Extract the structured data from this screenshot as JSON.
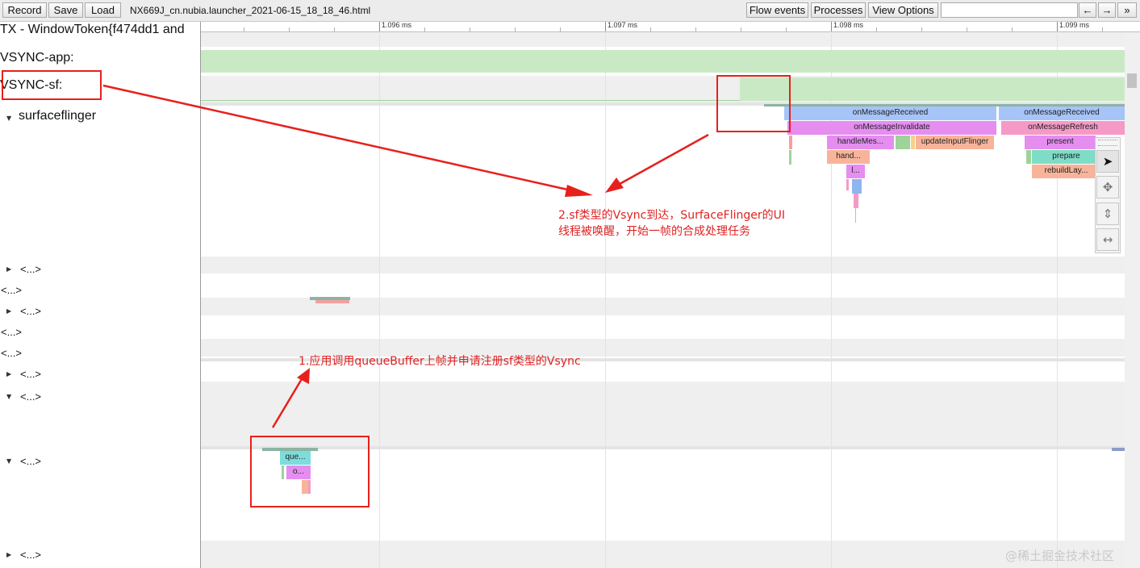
{
  "toolbar": {
    "record": "Record",
    "save": "Save",
    "load": "Load",
    "filename": "NX669J_cn.nubia.launcher_2021-06-15_18_18_46.html",
    "flow_events": "Flow events",
    "processes": "Processes",
    "view_options": "View Options",
    "prev": "←",
    "next": "→",
    "more": "»"
  },
  "left_panel": {
    "row0": "TX - WindowToken{f474dd1 and",
    "vsync_app": "VSYNC-app:",
    "vsync_sf": "VSYNC-sf:",
    "surfaceflinger": "surfaceflinger",
    "collapsed": "<...>"
  },
  "ruler": {
    "ticks": [
      "1.096 ms",
      "1.097 ms",
      "1.098 ms",
      "1.099 ms"
    ]
  },
  "slices": {
    "on_message_received": "onMessageReceived",
    "on_message_received_2": "onMessageReceived",
    "on_message_invalidate": "onMessageInvalidate",
    "on_message_refresh": "onMessageRefresh",
    "handle_message": "handleMes...",
    "update_input_flinger": "updateInputFlinger",
    "present": "present",
    "hand": "hand...",
    "prepare": "prepare",
    "rebuild_layers": "rebuildLay...",
    "l_short": "l...",
    "queue": "que...",
    "o_short": "o..."
  },
  "annotations": {
    "step2_line1": "2.sf类型的Vsync到达，SurfaceFlinger的UI",
    "step2_line2": "线程被唤醒，开始一帧的合成处理任务",
    "step1": "1.应用调用queueBuffer上帧并申请注册sf类型的Vsync"
  },
  "watermark": "@稀土掘金技术社区",
  "colors": {
    "vsync_green": "#c9e9c5",
    "blue": "#a7c4f8",
    "magenta": "#e58ef0",
    "salmon": "#f7b49a",
    "annotation_red": "#e02222"
  }
}
